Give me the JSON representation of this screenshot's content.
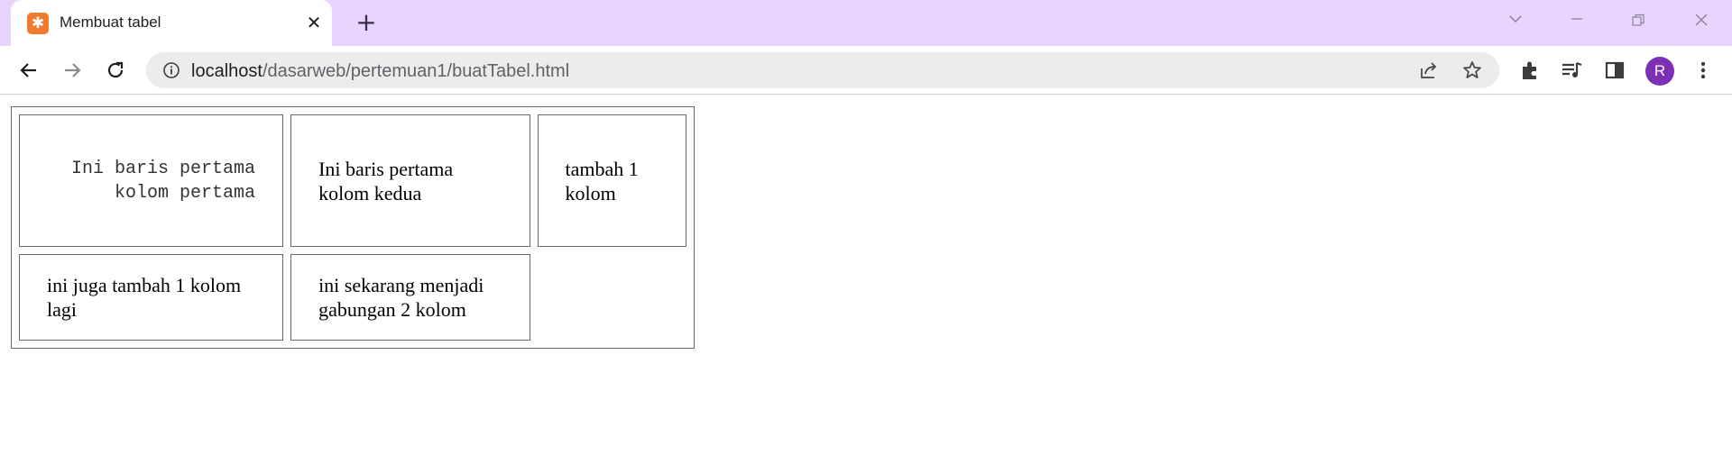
{
  "browser": {
    "tab_title": "Membuat tabel",
    "tab_favicon": "xampp-icon",
    "new_tab_label": "+",
    "close_tab_label": "✕",
    "url_host": "localhost",
    "url_path": "/dasarweb/pertemuan1/buatTabel.html",
    "profile_initial": "R",
    "colors": {
      "tab_strip": "#e8d4fe",
      "avatar": "#7b2fb5",
      "favicon": "#f07a2f"
    }
  },
  "table": {
    "rows": [
      [
        {
          "text": "Ini baris pertama kolom pertama"
        },
        {
          "text": "Ini baris pertama kolom kedua"
        },
        {
          "text": "tambah 1 kolom"
        }
      ],
      [
        {
          "text": "ini juga tambah 1 kolom lagi"
        },
        {
          "text": "ini sekarang menjadi gabungan 2 kolom"
        }
      ]
    ]
  }
}
